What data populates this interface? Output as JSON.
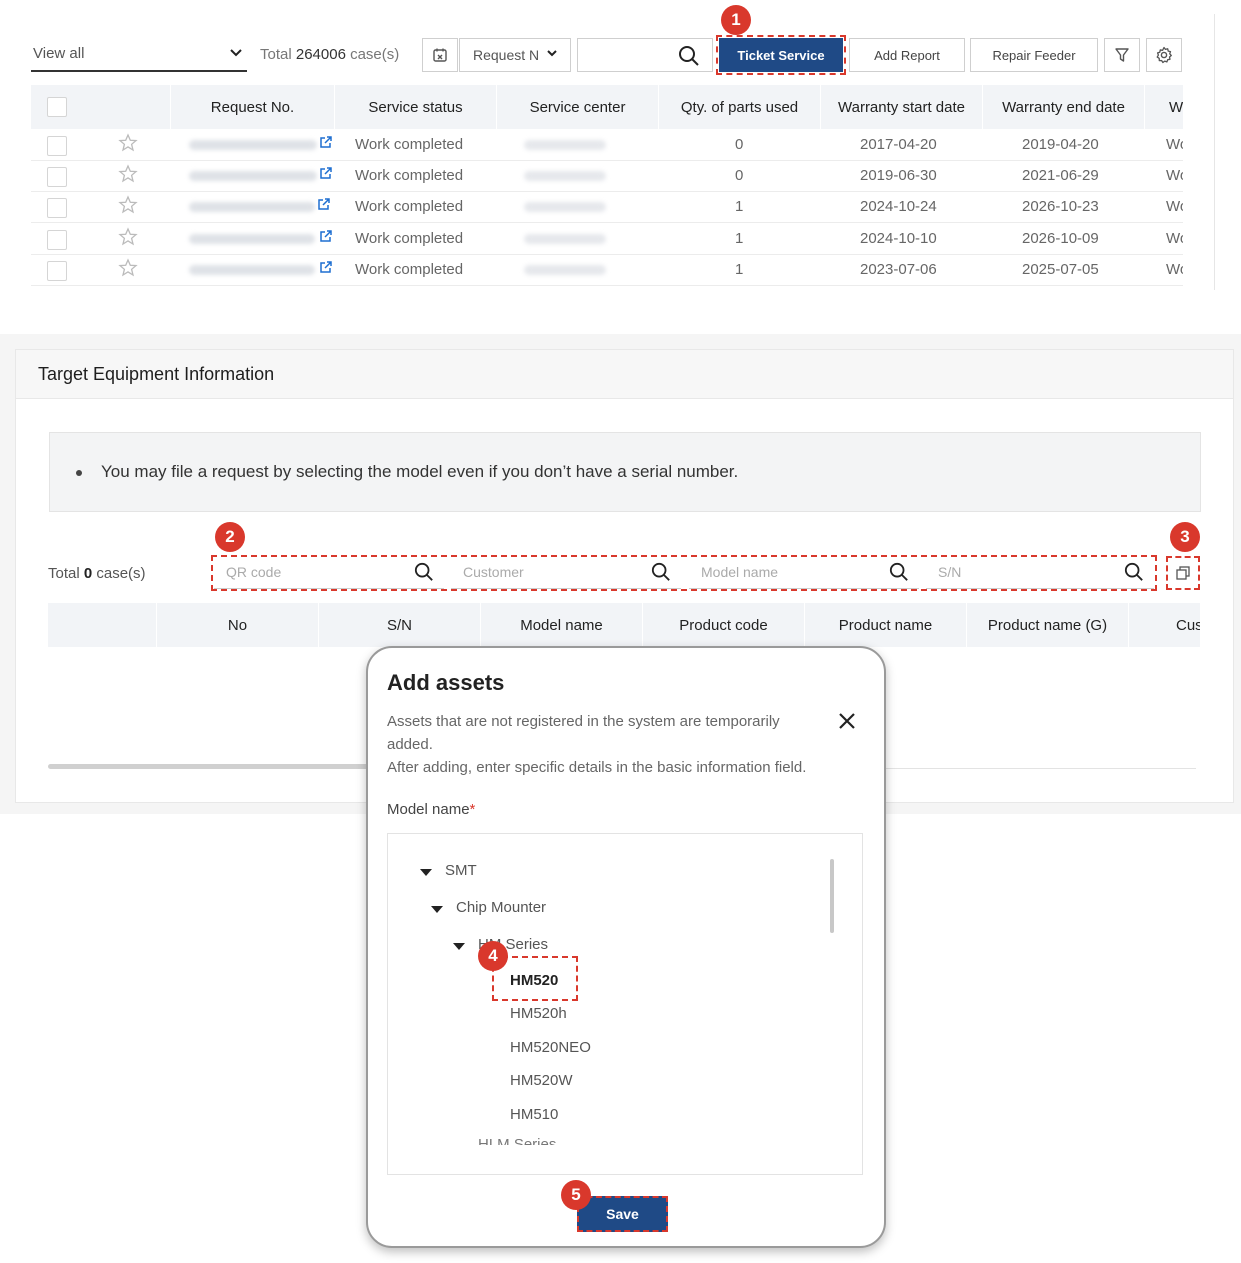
{
  "toolbar": {
    "view_select": "View all",
    "total_prefix": "Total ",
    "total_count": "264006",
    "total_suffix": " case(s)",
    "request_select": "Request N",
    "search_value": "",
    "ticket_service": "Ticket Service",
    "add_report": "Add Report",
    "repair_feeder": "Repair Feeder"
  },
  "grid": {
    "columns": [
      "Request No.",
      "Service status",
      "Service center",
      "Qty. of parts used",
      "Warranty start date",
      "Warranty end date",
      "W"
    ],
    "rows": [
      {
        "status": "Work completed",
        "qty": "0",
        "start": "2017-04-20",
        "end": "2019-04-20",
        "w": "Wo"
      },
      {
        "status": "Work completed",
        "qty": "0",
        "start": "2019-06-30",
        "end": "2021-06-29",
        "w": "Wo"
      },
      {
        "status": "Work completed",
        "qty": "1",
        "start": "2024-10-24",
        "end": "2026-10-23",
        "w": "Wo"
      },
      {
        "status": "Work completed",
        "qty": "1",
        "start": "2024-10-10",
        "end": "2026-10-09",
        "w": "Wo"
      },
      {
        "status": "Work completed",
        "qty": "1",
        "start": "2023-07-06",
        "end": "2025-07-05",
        "w": "Wo"
      }
    ]
  },
  "equipment": {
    "title": "Target Equipment Information",
    "notice": "You may file a request by selecting the model even if you don’t have a serial number.",
    "total_prefix": "Total ",
    "total_count": "0",
    "total_suffix": " case(s)",
    "search": {
      "qr_placeholder": "QR code",
      "customer_placeholder": "Customer",
      "model_placeholder": "Model name",
      "sn_placeholder": "S/N"
    },
    "columns": [
      "No",
      "S/N",
      "Model name",
      "Product code",
      "Product name",
      "Product name (G)",
      "Cus"
    ]
  },
  "modal": {
    "title": "Add assets",
    "desc_line1": "Assets that are not registered in the system are temporarily added.",
    "desc_line2": "After adding, enter specific details in the basic information field.",
    "model_label": "Model name",
    "required_mark": "*",
    "tree": {
      "root": "SMT",
      "level1": "Chip Mounter",
      "level2": "HM Series",
      "models": [
        "HM520",
        "HM520h",
        "HM520NEO",
        "HM520W",
        "HM510"
      ],
      "next_group": "HLM Series"
    },
    "save": "Save"
  },
  "badges": [
    "1",
    "2",
    "3",
    "4",
    "5"
  ],
  "colors": {
    "primary": "#1f4a86",
    "highlight": "#d9382c",
    "link": "#1f6fd1"
  }
}
